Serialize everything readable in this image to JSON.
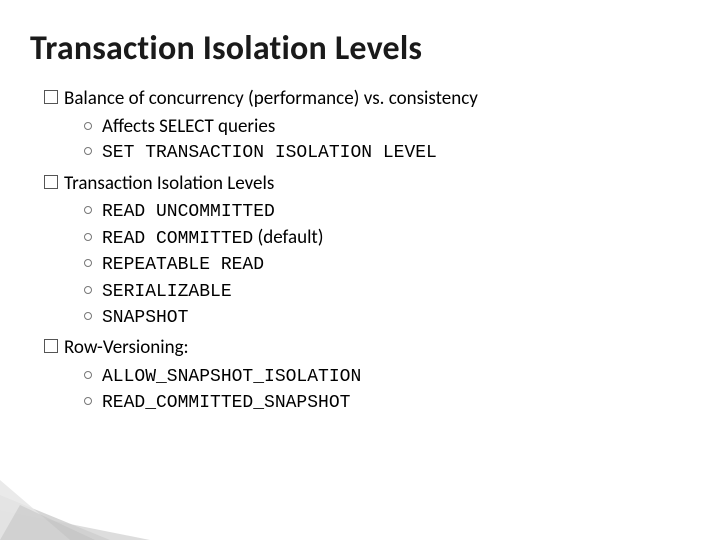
{
  "title": "Transaction Isolation Levels",
  "items": [
    {
      "lead": "Balance",
      "rest": " of concurrency (performance) vs. consistency",
      "sub": [
        {
          "text": "Affects SELECT queries",
          "mono": false
        },
        {
          "text": "SET TRANSACTION ISOLATION LEVEL",
          "mono": true
        }
      ]
    },
    {
      "lead": "Transaction",
      "rest": " Isolation Levels",
      "sub": [
        {
          "text": "READ UNCOMMITTED",
          "mono": true
        },
        {
          "text": "READ COMMITTED",
          "mono": true,
          "suffix": " (default)"
        },
        {
          "text": "REPEATABLE READ",
          "mono": true
        },
        {
          "text": "SERIALIZABLE",
          "mono": true
        },
        {
          "text": "SNAPSHOT",
          "mono": true
        }
      ]
    },
    {
      "lead": "Row-Versioning:",
      "rest": "",
      "sub": [
        {
          "text": "ALLOW_SNAPSHOT_ISOLATION",
          "mono": true
        },
        {
          "text": "READ_COMMITTED_SNAPSHOT",
          "mono": true
        }
      ]
    }
  ]
}
